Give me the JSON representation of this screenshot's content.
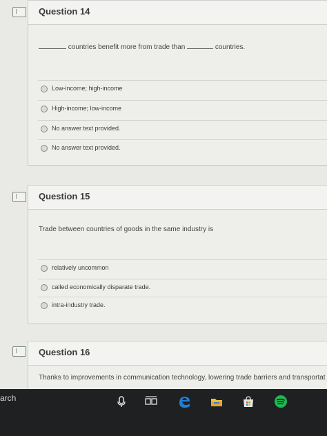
{
  "questions": [
    {
      "title": "Question 14",
      "text_parts": [
        "countries benefit more from trade than",
        "countries."
      ],
      "options": [
        "Low-income; high-income",
        "High-income; low-income",
        "No answer text provided.",
        "No answer text provided."
      ]
    },
    {
      "title": "Question 15",
      "text": "Trade between countries of goods in the same industry is",
      "options": [
        "relatively uncommon",
        "called economically disparate trade.",
        "intra-industry trade."
      ]
    },
    {
      "title": "Question 16",
      "text": "Thanks to improvements in communication technology, lowering trade barriers and transportat"
    }
  ],
  "taskbar": {
    "search_label": "arch",
    "icons": [
      "microphone-icon",
      "task-view-icon",
      "edge-browser-icon",
      "file-explorer-icon",
      "store-icon",
      "spotify-icon"
    ]
  },
  "colors": {
    "page_bg": "#e9e9e6",
    "card_bg": "#eeeeeb",
    "taskbar_bg": "#1f2022",
    "edge_blue": "#1f7fd6",
    "spotify_green": "#1db954"
  }
}
